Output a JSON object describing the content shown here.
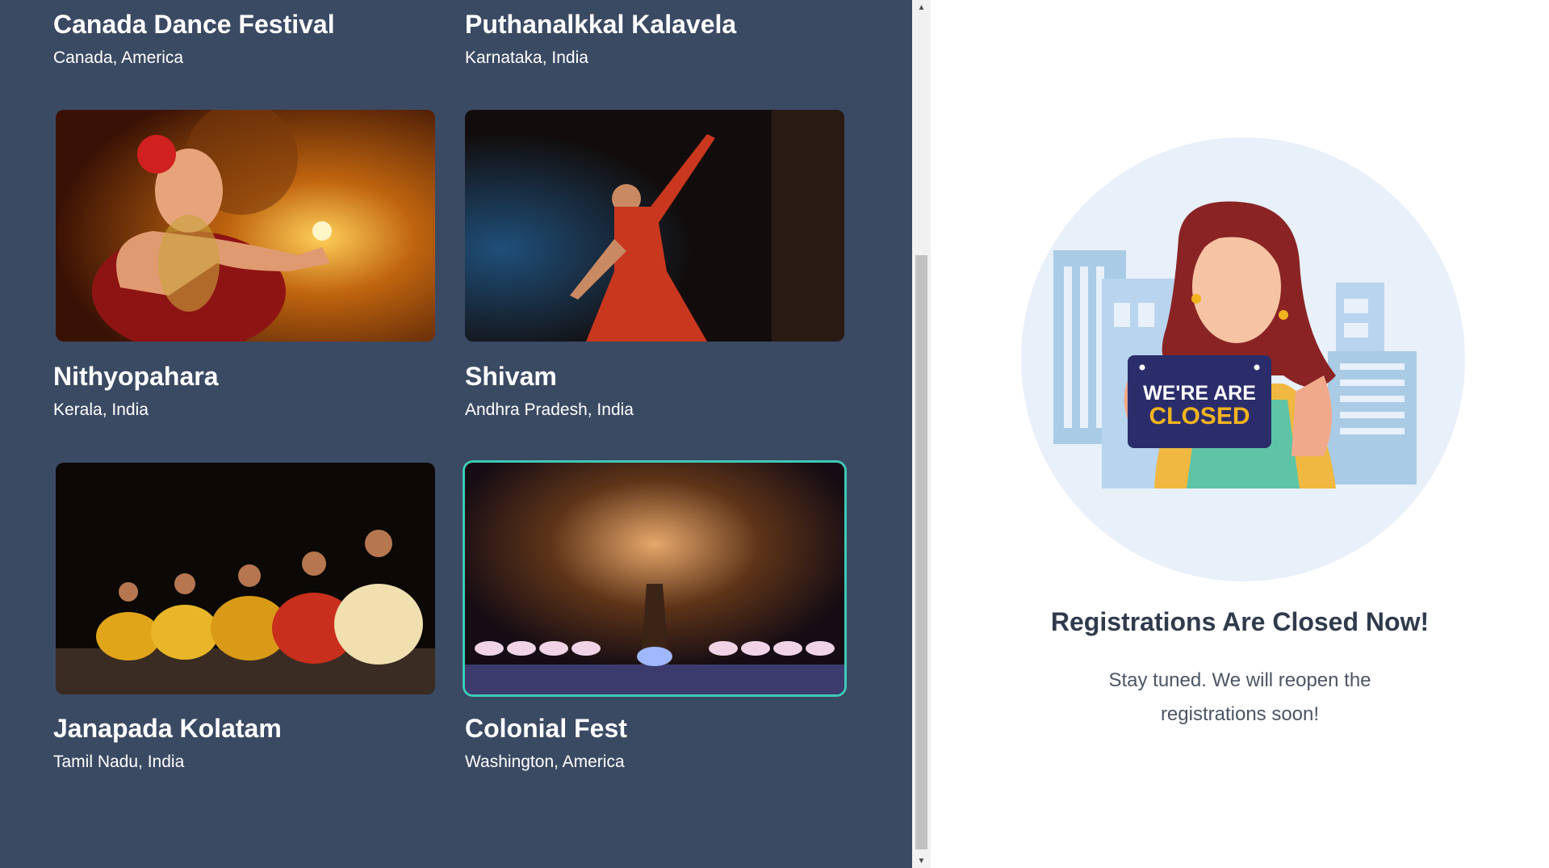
{
  "events": [
    {
      "title": "Canada Dance Festival",
      "location": "Canada, America"
    },
    {
      "title": "Puthanalkkal Kalavela",
      "location": "Karnataka, India"
    },
    {
      "title": "Nithyopahara",
      "location": "Kerala, India"
    },
    {
      "title": "Shivam",
      "location": "Andhra Pradesh, India"
    },
    {
      "title": "Janapada Kolatam",
      "location": "Tamil Nadu, India"
    },
    {
      "title": "Colonial Fest",
      "location": "Washington, America"
    }
  ],
  "sign": {
    "line1": "WE'RE ARE",
    "line2": "CLOSED"
  },
  "registration": {
    "heading": "Registrations Are Closed Now!",
    "message": "Stay tuned. We will reopen the registrations soon!"
  },
  "colors": {
    "panel_bg": "#3b4a63",
    "selected_border": "#3ec9b6",
    "heading": "#2f3b4c"
  }
}
